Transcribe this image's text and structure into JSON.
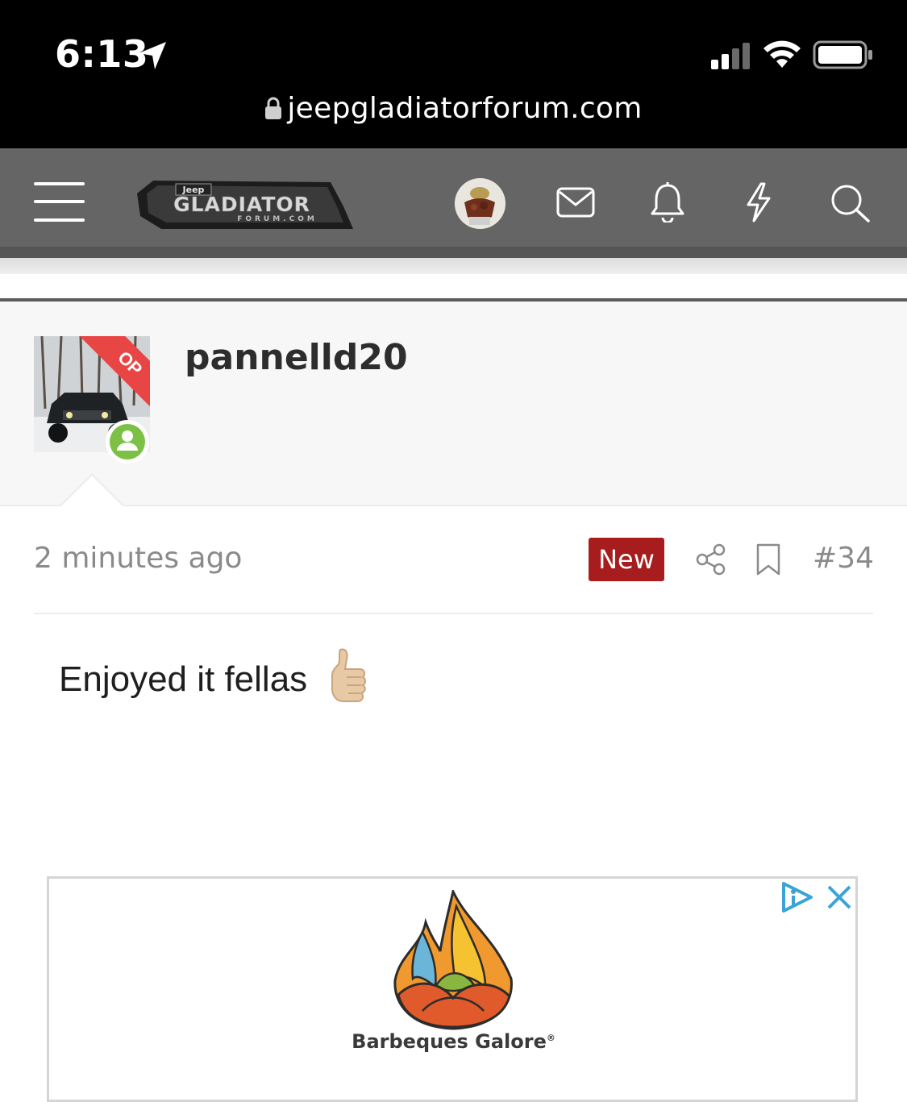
{
  "status_bar": {
    "time": "6:13",
    "url": "jeepgladiatorforum.com"
  },
  "nav": {
    "logo_top": "Jeep",
    "logo_main": "GLADIATOR",
    "logo_sub": "FORUM.COM",
    "icons": [
      "menu-icon",
      "avatar",
      "envelope-icon",
      "bell-icon",
      "lightning-icon",
      "search-icon"
    ]
  },
  "post": {
    "username": "pannelld20",
    "op_badge": "OP",
    "time": "2 minutes ago",
    "new_label": "New",
    "number": "#34",
    "body": "Enjoyed it fellas",
    "emoji": "👍"
  },
  "ad": {
    "brand": "Barbeques Galore",
    "trademark": "®"
  },
  "colors": {
    "status_bar_bg": "#000000",
    "navbar_bg": "#656565",
    "new_badge_bg": "#a71d1d",
    "op_ribbon": "#e84545",
    "online_green": "#7cc146"
  }
}
